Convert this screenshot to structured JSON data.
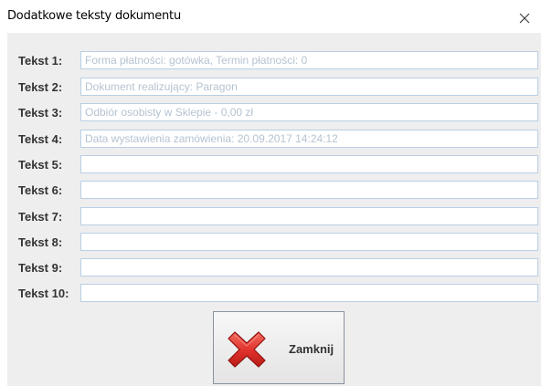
{
  "window": {
    "title": "Dodatkowe teksty dokumentu"
  },
  "fields": [
    {
      "label": "Tekst 1:",
      "value": "Forma płatności: gotówka, Termin płatności: 0"
    },
    {
      "label": "Tekst 2:",
      "value": "Dokument realizujący: Paragon"
    },
    {
      "label": "Tekst 3:",
      "value": "Odbiór osobisty w Sklepie - 0,00 zł"
    },
    {
      "label": "Tekst 4:",
      "value": "Data wystawienia zamówienia: 20.09.2017 14:24:12"
    },
    {
      "label": "Tekst 5:",
      "value": ""
    },
    {
      "label": "Tekst 6:",
      "value": ""
    },
    {
      "label": "Tekst 7:",
      "value": ""
    },
    {
      "label": "Tekst 8:",
      "value": ""
    },
    {
      "label": "Tekst 9:",
      "value": ""
    },
    {
      "label": "Tekst 10:",
      "value": ""
    }
  ],
  "actions": {
    "close_label": "Zamknij",
    "close_icon": "red-x-icon"
  },
  "colors": {
    "input_border": "#b8cfe5",
    "input_text": "#b6c3d1",
    "panel_bg": "#eeeeee",
    "icon_red": "#e0302a"
  }
}
